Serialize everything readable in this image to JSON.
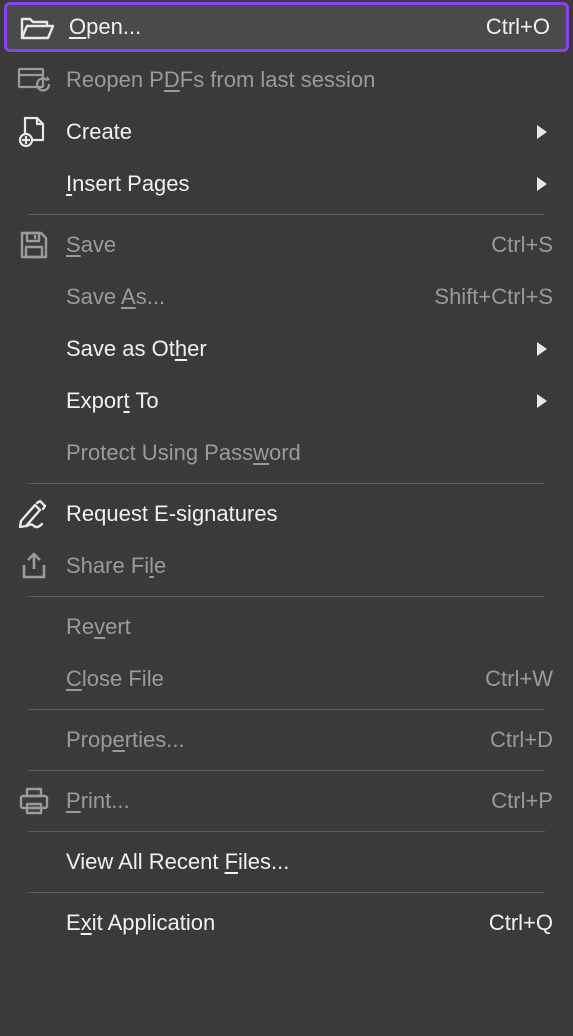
{
  "menu": {
    "open": {
      "label": "Open...",
      "shortcut": "Ctrl+O"
    },
    "reopen": {
      "label": "Reopen PDFs from last session"
    },
    "create": {
      "label": "Create"
    },
    "insert_pages": {
      "label": "Insert Pages"
    },
    "save": {
      "label": "Save",
      "shortcut": "Ctrl+S"
    },
    "save_as": {
      "label": "Save As...",
      "shortcut": "Shift+Ctrl+S"
    },
    "save_as_other": {
      "label": "Save as Other"
    },
    "export_to": {
      "label": "Export To"
    },
    "protect": {
      "label": "Protect Using Password"
    },
    "request_sig": {
      "label": "Request E-signatures"
    },
    "share_file": {
      "label": "Share File"
    },
    "revert": {
      "label": "Revert"
    },
    "close_file": {
      "label": "Close File",
      "shortcut": "Ctrl+W"
    },
    "properties": {
      "label": "Properties...",
      "shortcut": "Ctrl+D"
    },
    "print": {
      "label": "Print...",
      "shortcut": "Ctrl+P"
    },
    "view_recent": {
      "label": "View All Recent Files..."
    },
    "exit": {
      "label": "Exit Application",
      "shortcut": "Ctrl+Q"
    }
  }
}
